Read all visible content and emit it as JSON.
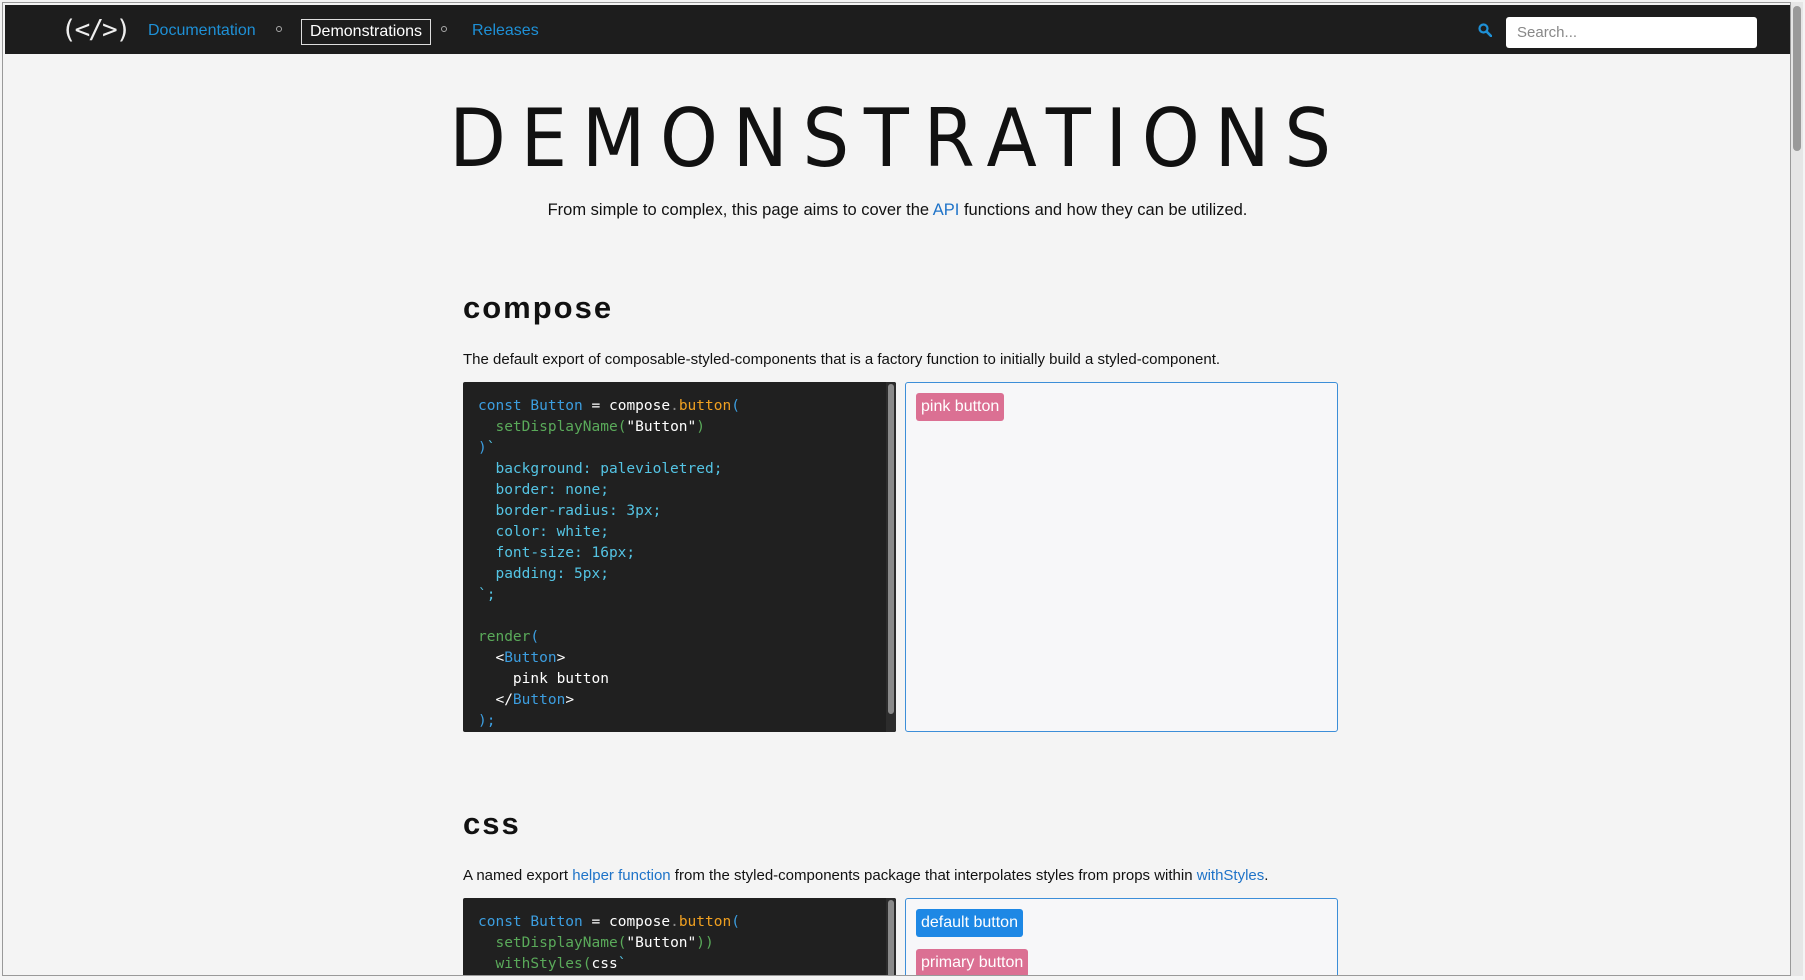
{
  "nav": {
    "logo": "(</>)",
    "links": [
      "Documentation",
      "Demonstrations",
      "Releases"
    ],
    "active": "Demonstrations",
    "search_placeholder": "Search..."
  },
  "hero": {
    "title": "DEMONSTRATIONS",
    "sub_before": "From simple to complex, this page aims to cover the ",
    "sub_link": "API",
    "sub_after": " functions and how they can be utilized."
  },
  "sections": [
    {
      "title": "compose",
      "desc": "The default export of composable-styled-components that is a factory function to initially build a styled-component.",
      "preview_button": "pink button"
    },
    {
      "title": "css",
      "desc_before": "A named export ",
      "desc_link1": "helper function",
      "desc_mid": " from the styled-components package that interpolates styles from props within ",
      "desc_link2": "withStyles",
      "desc_after": ".",
      "preview_buttons": [
        "default button",
        "primary button"
      ]
    }
  ],
  "code": {
    "compose": {
      "l1": [
        "const ",
        "Button",
        " = ",
        "compose",
        ".",
        "button",
        "("
      ],
      "l2": [
        "  ",
        "setDisplayName",
        "(",
        "\"Button\"",
        ")"
      ],
      "l3": [
        ")",
        "`"
      ],
      "l4": "  background: palevioletred;",
      "l5": "  border: none;",
      "l6": "  border-radius: 3px;",
      "l7": "  color: white;",
      "l8": "  font-size: 16px;",
      "l9": "  padding: 5px;",
      "l10": "`;",
      "l12": [
        "render",
        "("
      ],
      "l13": [
        "  <",
        "Button",
        ">"
      ],
      "l14": "    pink button",
      "l15": [
        "  </",
        "Button",
        ">"
      ],
      "l16": ");"
    },
    "css": {
      "l1": [
        "const ",
        "Button",
        " = ",
        "compose",
        ".",
        "button",
        "("
      ],
      "l2": [
        "  ",
        "setDisplayName",
        "(",
        "\"Button\"",
        "))"
      ],
      "l3": [
        "  ",
        "withStyles",
        "(",
        "css",
        "`"
      ]
    }
  },
  "colors": {
    "nav_bg": "#1d1d1d",
    "link": "#1e90d6",
    "pink": "#db7093",
    "blue": "#1e88e5"
  }
}
